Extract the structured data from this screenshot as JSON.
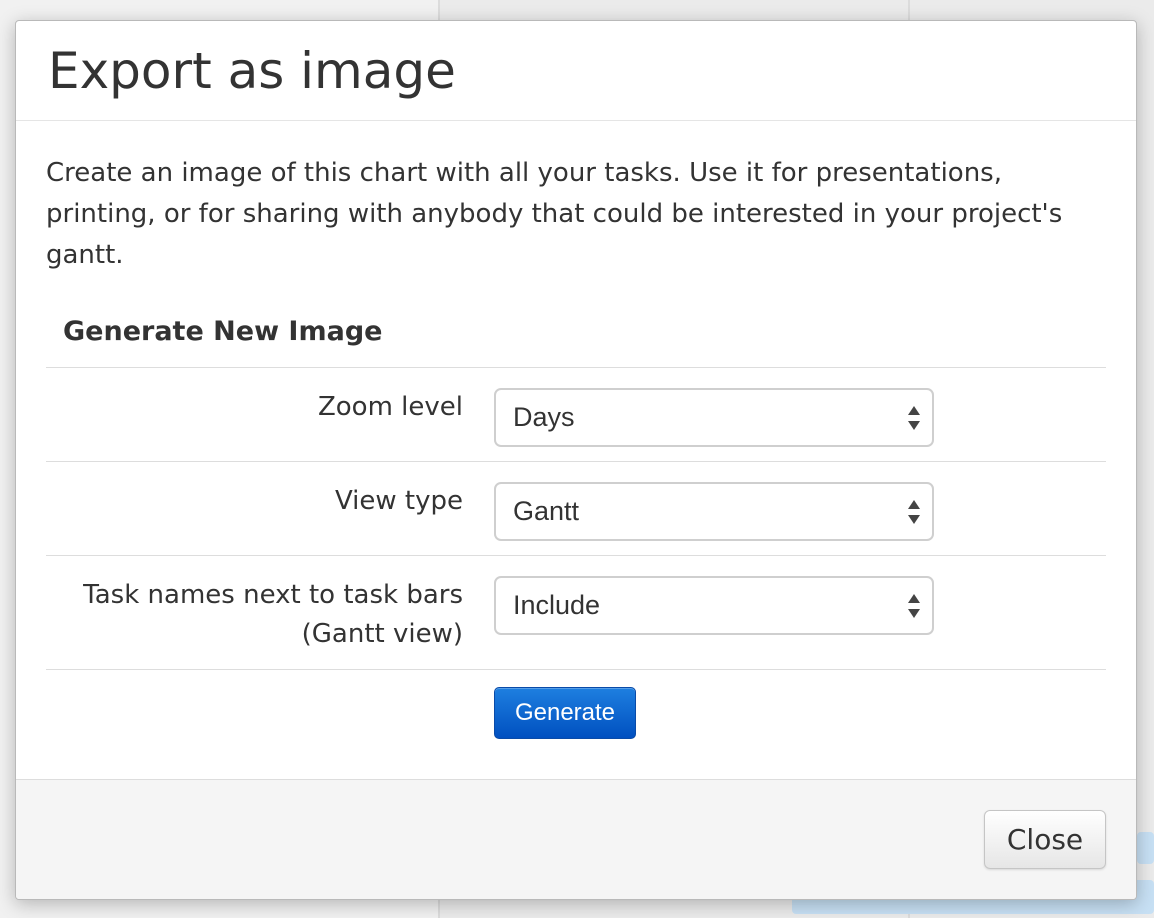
{
  "modal": {
    "title": "Export as image",
    "intro": "Create an image of this chart with all your tasks. Use it for presentations, printing, or for sharing with anybody that could be interested in your project's gantt.",
    "section_title": "Generate New Image",
    "fields": [
      {
        "label": "Zoom level",
        "value": "Days"
      },
      {
        "label": "View type",
        "value": "Gantt"
      },
      {
        "label": "Task names next to task bars",
        "label_line2": "(Gantt view)",
        "value": "Include"
      }
    ],
    "generate_label": "Generate",
    "close_label": "Close"
  },
  "colors": {
    "primary_button": "#0b63d6",
    "footer_bg": "#f5f5f5"
  }
}
